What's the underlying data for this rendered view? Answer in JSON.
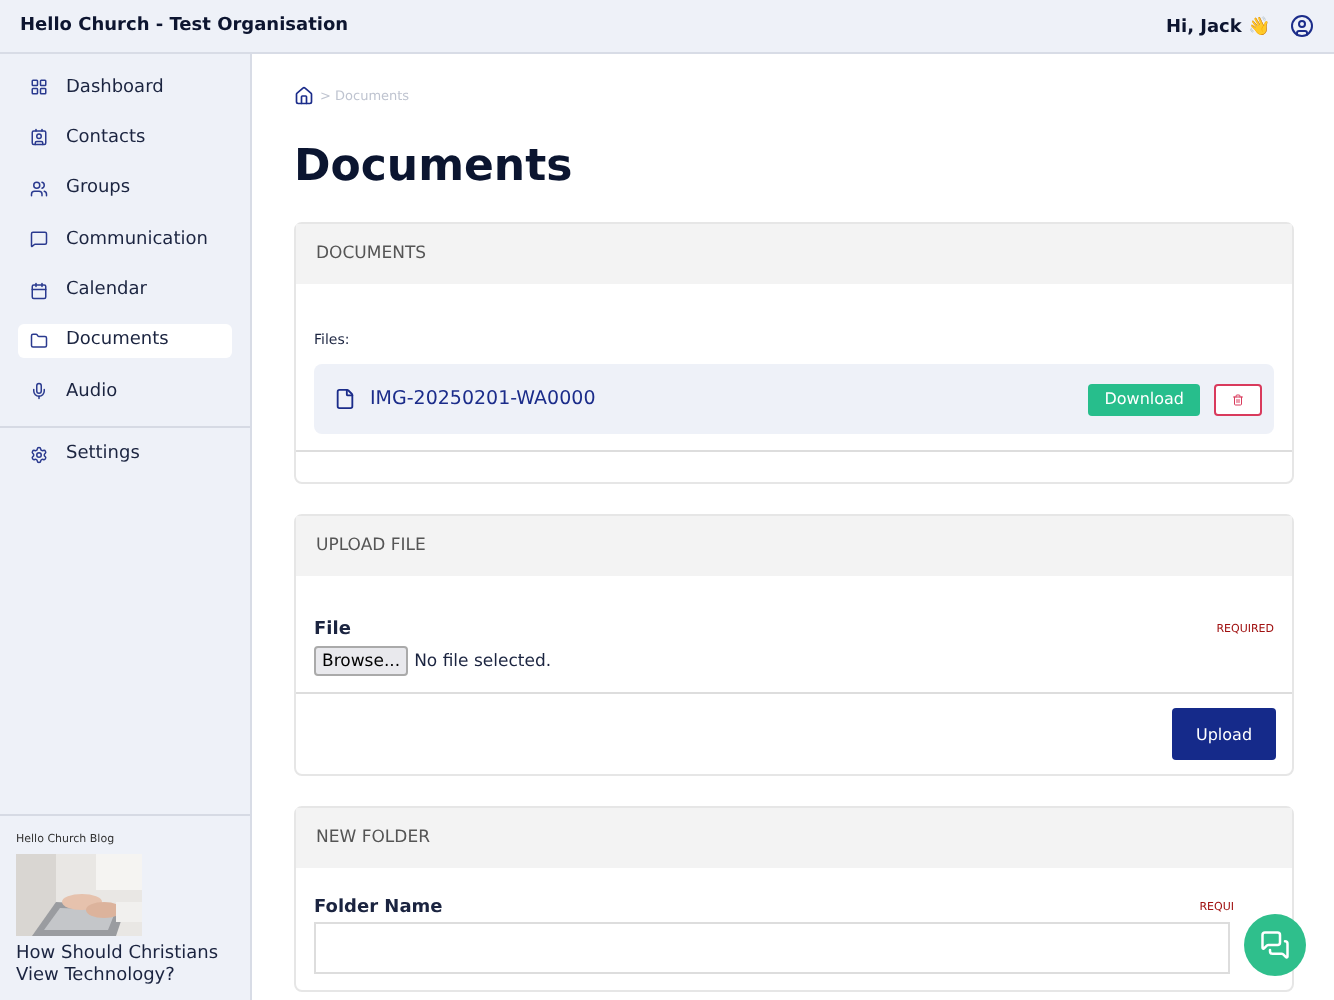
{
  "header": {
    "title": "Hello Church - Test Organisation",
    "greeting": "Hi, Jack 👋"
  },
  "sidebar": {
    "items": [
      {
        "label": "Dashboard",
        "selected": false
      },
      {
        "label": "Contacts",
        "selected": false
      },
      {
        "label": "Groups",
        "selected": false
      },
      {
        "label": "Communication",
        "selected": false
      },
      {
        "label": "Calendar",
        "selected": false
      },
      {
        "label": "Documents",
        "selected": true
      },
      {
        "label": "Audio",
        "selected": false
      }
    ],
    "bottom_items": [
      {
        "label": "Settings",
        "selected": false
      }
    ],
    "blog": {
      "heading": "Hello Church Blog",
      "title": "How Should Christians View Technology?"
    }
  },
  "breadcrumb": {
    "separator": ">",
    "current": "Documents"
  },
  "page_title": "Documents",
  "documents_card": {
    "title": "DOCUMENTS",
    "files_label": "Files:",
    "files": [
      {
        "name": "IMG-20250201-WA0000",
        "download": "Download"
      }
    ]
  },
  "upload_card": {
    "title": "UPLOAD FILE",
    "field_label": "File",
    "required": "REQUIRED",
    "browse": "Browse...",
    "no_file": "No file selected.",
    "button": "Upload"
  },
  "folder_card": {
    "title": "NEW FOLDER",
    "field_label": "Folder Name",
    "required": "REQUI"
  }
}
